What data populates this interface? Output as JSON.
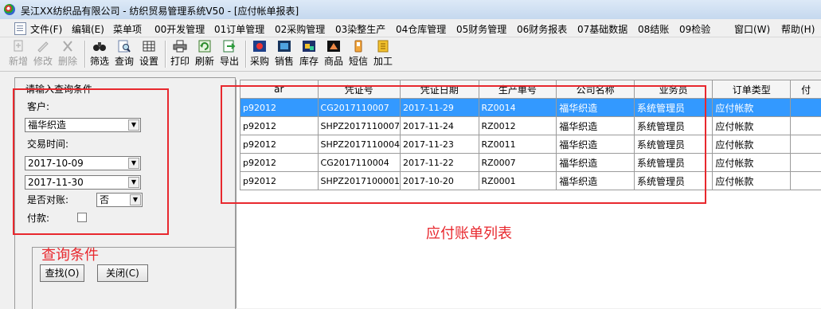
{
  "window": {
    "title": "吴江XX纺织品有限公司 - 纺织贸易管理系统V50 - [应付帐单报表]"
  },
  "menu": [
    {
      "label": "文件(F)"
    },
    {
      "label": "编辑(E)"
    },
    {
      "label": "菜单项"
    },
    {
      "label": "00开发管理"
    },
    {
      "label": "01订单管理"
    },
    {
      "label": "02采购管理"
    },
    {
      "label": "03染整生产"
    },
    {
      "label": "04仓库管理"
    },
    {
      "label": "05财务管理"
    },
    {
      "label": "06财务报表"
    },
    {
      "label": "07基础数据"
    },
    {
      "label": "08结账"
    },
    {
      "label": "09检验"
    },
    {
      "label": "窗口(W)"
    },
    {
      "label": "帮助(H)"
    }
  ],
  "toolbar": [
    {
      "label": "新增",
      "icon": "add-doc-icon",
      "enabled": false
    },
    {
      "label": "修改",
      "icon": "pen-icon",
      "enabled": false
    },
    {
      "label": "删除",
      "icon": "delete-x-icon",
      "enabled": false
    },
    {
      "label": "筛选",
      "icon": "binoculars-icon",
      "enabled": true
    },
    {
      "label": "查询",
      "icon": "magnifier-doc-icon",
      "enabled": true
    },
    {
      "label": "设置",
      "icon": "grid-settings-icon",
      "enabled": true
    },
    {
      "label": "打印",
      "icon": "printer-icon",
      "enabled": true
    },
    {
      "label": "刷新",
      "icon": "refresh-icon",
      "enabled": true
    },
    {
      "label": "导出",
      "icon": "export-icon",
      "enabled": true
    },
    {
      "label": "采购",
      "icon": "purchase-icon",
      "enabled": true
    },
    {
      "label": "销售",
      "icon": "sales-icon",
      "enabled": true
    },
    {
      "label": "库存",
      "icon": "stock-icon",
      "enabled": true
    },
    {
      "label": "商品",
      "icon": "goods-icon",
      "enabled": true
    },
    {
      "label": "短信",
      "icon": "sms-icon",
      "enabled": true
    },
    {
      "label": "加工",
      "icon": "process-icon",
      "enabled": true
    }
  ],
  "query": {
    "title": "请输入查询条件",
    "customer_label": "客户:",
    "customer_value": "福华织造",
    "time_label": "交易时间:",
    "date_from": "2017-10-09",
    "date_to": "2017-11-30",
    "reconciled_label": "是否对账:",
    "reconciled_value": "否",
    "paid_label": "付款:",
    "paid_checked": false,
    "find_button": "查找(O)",
    "close_button": "关闭(C)"
  },
  "grid": {
    "columns": [
      "ar",
      "凭证号",
      "凭证日期",
      "生产单号",
      "公司名称",
      "业务员",
      "订单类型",
      "付"
    ],
    "rows": [
      [
        "p92012",
        "CG2017110007",
        "2017-11-29",
        "RZ0014",
        "福华织造",
        "系统管理员",
        "应付帐款"
      ],
      [
        "p92012",
        "SHPZ2017110007",
        "2017-11-24",
        "RZ0012",
        "福华织造",
        "系统管理员",
        "应付帐款"
      ],
      [
        "p92012",
        "SHPZ2017110004",
        "2017-11-23",
        "RZ0011",
        "福华织造",
        "系统管理员",
        "应付帐款"
      ],
      [
        "p92012",
        "CG2017110004",
        "2017-11-22",
        "RZ0007",
        "福华织造",
        "系统管理员",
        "应付帐款"
      ],
      [
        "p92012",
        "SHPZ2017100001",
        "2017-10-20",
        "RZ0001",
        "福华织造",
        "系统管理员",
        "应付帐款"
      ]
    ],
    "selected_row": 0
  },
  "annotations": {
    "query_label": "查询条件",
    "list_label": "应付账单列表",
    "color": "#e8282e"
  }
}
